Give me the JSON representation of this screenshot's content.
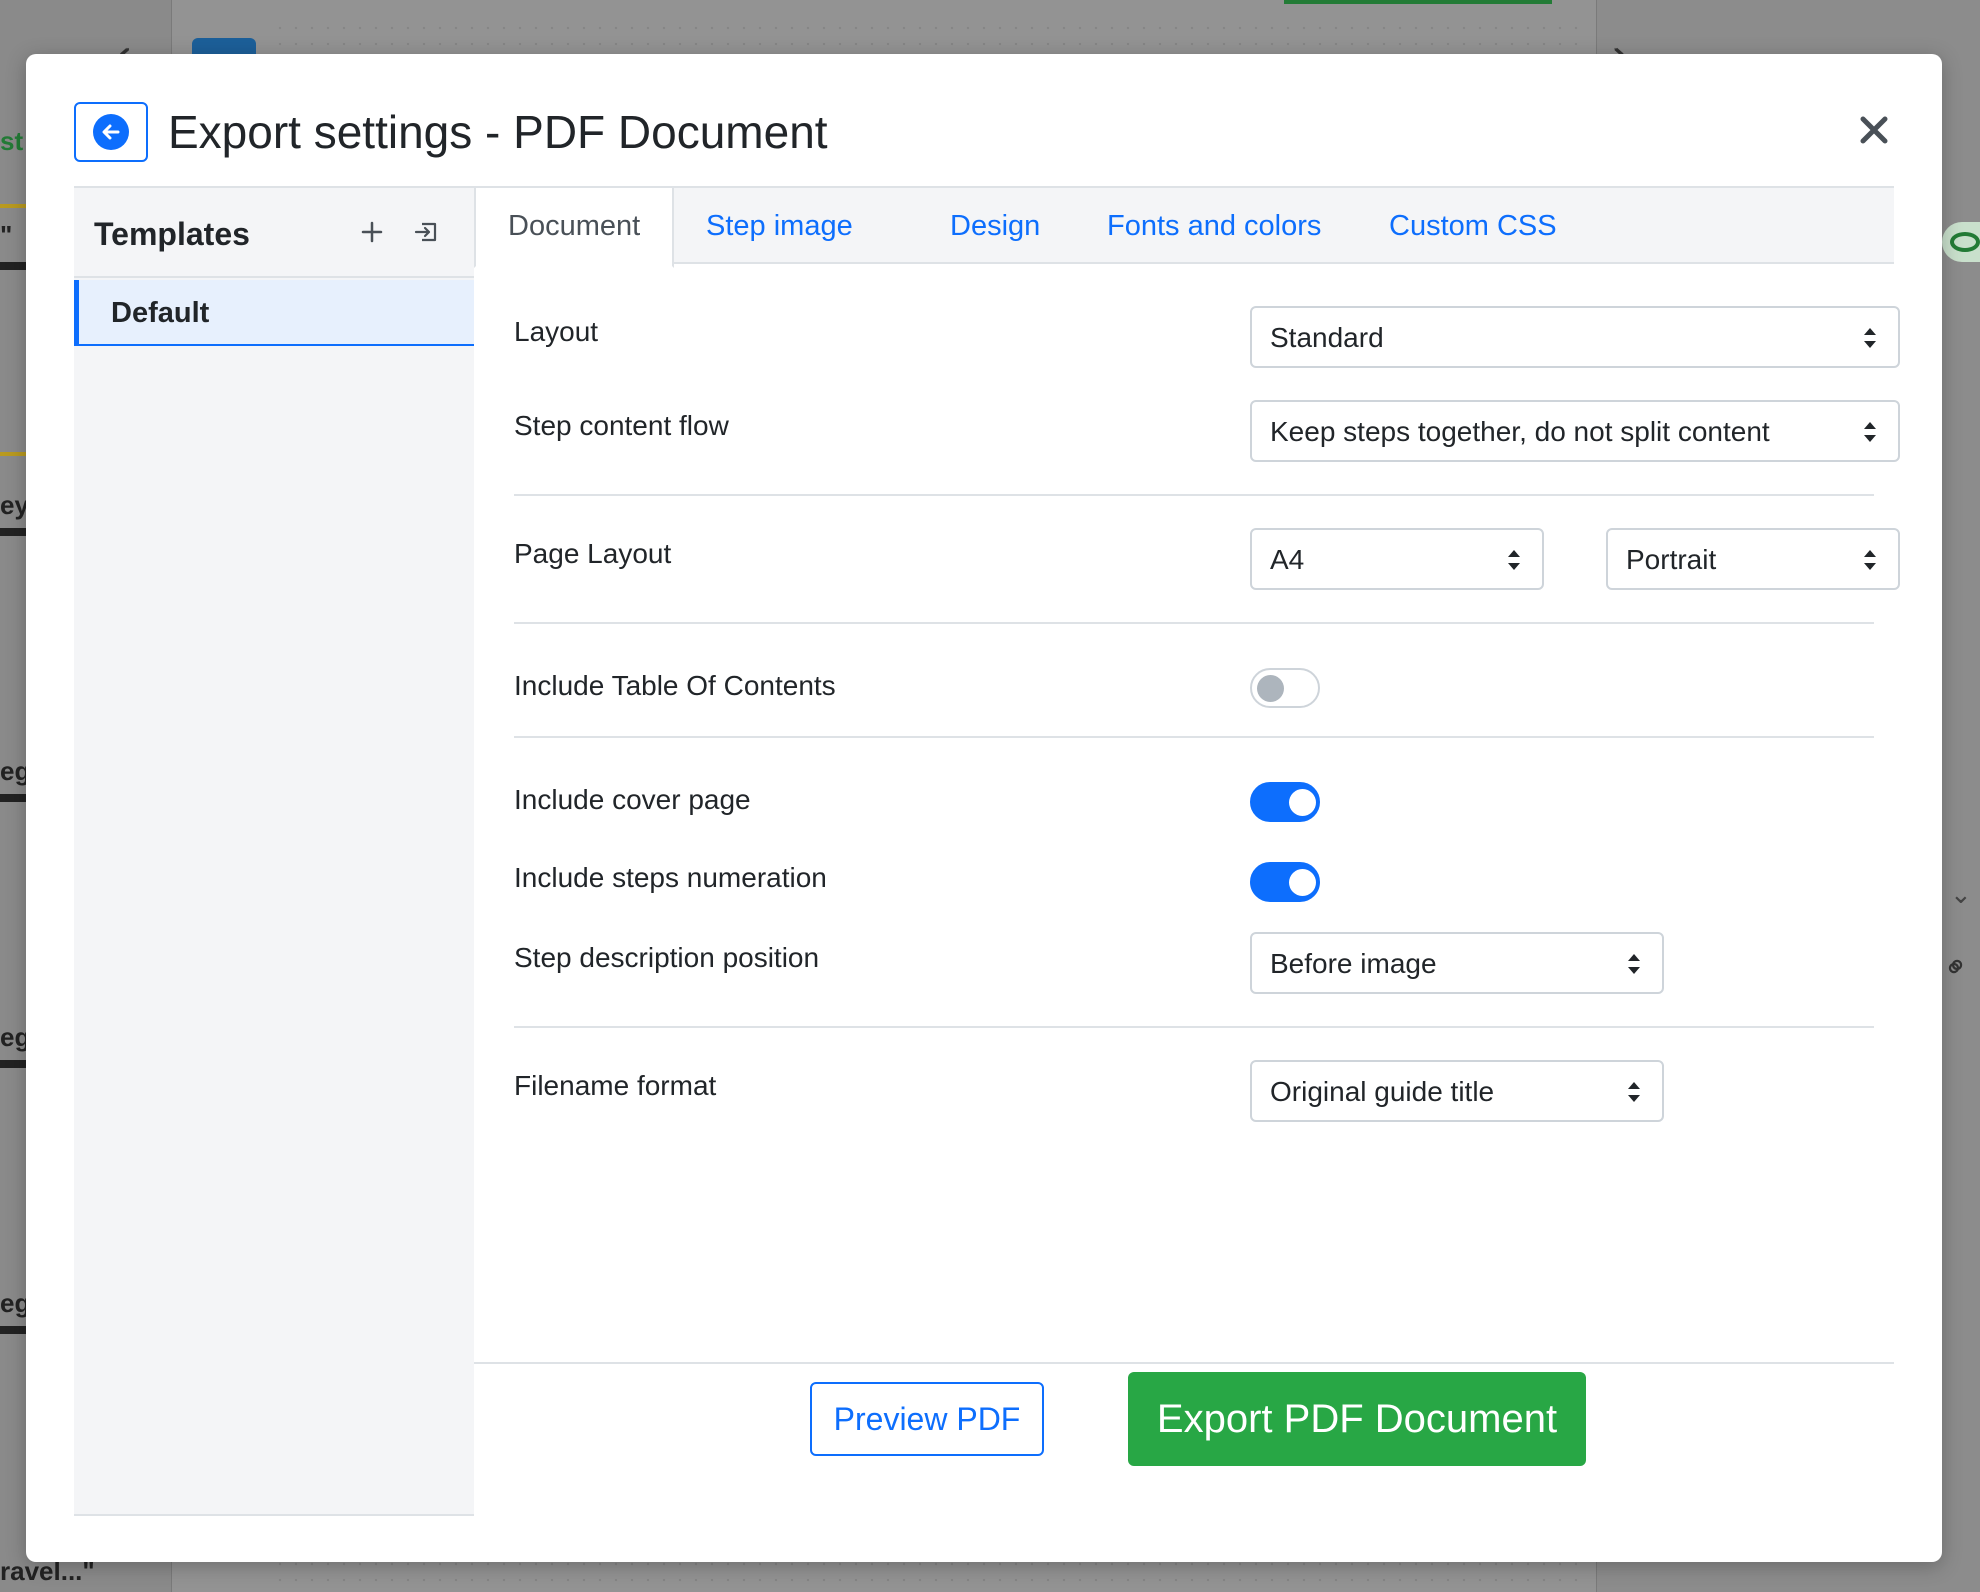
{
  "modal": {
    "title": "Export settings - PDF Document"
  },
  "sidebar": {
    "title": "Templates",
    "items": [
      {
        "label": "Default",
        "selected": true
      }
    ]
  },
  "tabs": [
    {
      "label": "Document",
      "active": true
    },
    {
      "label": "Step image",
      "active": false
    },
    {
      "label": "Design",
      "active": false
    },
    {
      "label": "Fonts and colors",
      "active": false
    },
    {
      "label": "Custom CSS",
      "active": false
    }
  ],
  "settings": {
    "layout": {
      "label": "Layout",
      "value": "Standard"
    },
    "step_content_flow": {
      "label": "Step content flow",
      "value": "Keep steps together, do not split content"
    },
    "page_layout": {
      "label": "Page Layout",
      "size": "A4",
      "orientation": "Portrait"
    },
    "table_of_contents": {
      "label": "Include Table Of Contents",
      "enabled": false
    },
    "cover_page": {
      "label": "Include cover page",
      "enabled": true
    },
    "steps_numeration": {
      "label": "Include steps numeration",
      "enabled": true
    },
    "step_description_position": {
      "label": "Step description position",
      "value": "Before image"
    },
    "filename_format": {
      "label": "Filename format",
      "value": "Original guide title"
    }
  },
  "footer": {
    "preview_label": "Preview PDF",
    "export_label": "Export PDF Document"
  },
  "background": {
    "fragments": [
      "st",
      "\"",
      "ey",
      "eg",
      "eg",
      "eg",
      "ravel...\""
    ]
  },
  "colors": {
    "primary": "#0d6efd",
    "success": "#28a745",
    "sidebar_bg": "#f4f5f7",
    "border": "#dee2e6"
  }
}
